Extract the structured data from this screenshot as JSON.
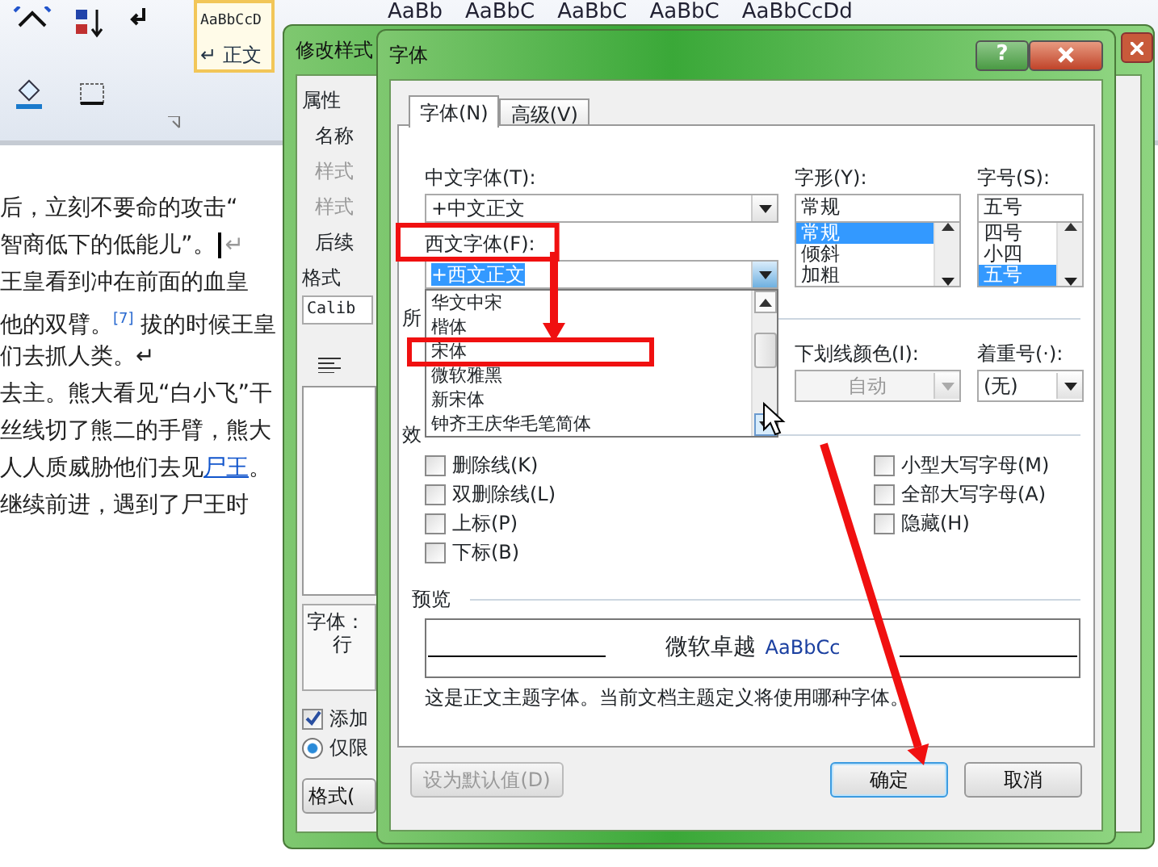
{
  "ribbon": {
    "gallery": [
      {
        "sample": "AaBbCcD",
        "name": "↵ 正文",
        "selected": true
      }
    ],
    "style_samples": [
      "AaBb",
      "AaBbC",
      "AaBbC",
      "AaBbC",
      "AaBbCcDd"
    ]
  },
  "document": {
    "lines": [
      [
        {
          "kind": "text",
          "text": "后，立刻不要命的攻击“"
        }
      ],
      [
        {
          "kind": "text",
          "text": "智商低下的低能儿”。"
        },
        {
          "kind": "caret",
          "text": "↵"
        }
      ],
      [
        {
          "kind": "text",
          "text": "王皇看到冲在前面的血皇"
        }
      ],
      [
        {
          "kind": "text",
          "text": "他的双臂。"
        },
        {
          "kind": "footnote",
          "text": "[7]"
        },
        {
          "kind": "text",
          "text": " 拔的时候王皇"
        }
      ],
      [
        {
          "kind": "text",
          "text": "们去抓人类。↵"
        }
      ],
      [
        {
          "kind": "text",
          "text": "去主。熊大看见“白小飞”干"
        }
      ],
      [
        {
          "kind": "text",
          "text": "丝线切了熊二的手臂，熊大"
        }
      ],
      [
        {
          "kind": "text",
          "text": "人人质威胁他们去见"
        },
        {
          "kind": "link",
          "text": "尸王"
        },
        {
          "kind": "text",
          "text": "。"
        }
      ],
      [
        {
          "kind": "text",
          "text": "继续前进，遇到了尸王时"
        }
      ]
    ]
  },
  "modify_style_dialog": {
    "title": "修改样式",
    "properties_heading": "属性",
    "labels": [
      {
        "text": "名称",
        "disabled": false
      },
      {
        "text": "样式",
        "disabled": true
      },
      {
        "text": "样式",
        "disabled": true
      },
      {
        "text": "后续",
        "disabled": false
      }
    ],
    "format_heading": "格式",
    "font_combo": "Calib",
    "description": [
      "字体：",
      "行"
    ],
    "add_to_gallery": {
      "label": "添加",
      "checked": true
    },
    "this_document_only": {
      "label": "仅限",
      "selected": true
    },
    "format_button": "格式("
  },
  "font_dialog": {
    "title": "字体",
    "help_button": "?",
    "tabs": [
      {
        "label": "字体(N)",
        "selected": true
      },
      {
        "label": "高级(V)",
        "selected": false
      }
    ],
    "chinese_font": {
      "label": "中文字体(T):",
      "value": "+中文正文"
    },
    "western_font": {
      "label": "西文字体(F):",
      "value": "+西文正文",
      "expanded": true,
      "options": [
        {
          "label": "华文中宋",
          "selected": false
        },
        {
          "label": "楷体",
          "selected": false
        },
        {
          "label": "宋体",
          "selected": false
        },
        {
          "label": "微软雅黑",
          "selected": false
        },
        {
          "label": "新宋体",
          "selected": false
        },
        {
          "label": "钟齐王庆华毛笔简体",
          "selected": false
        }
      ]
    },
    "font_style": {
      "label": "字形(Y):",
      "value": "常规",
      "options": [
        {
          "label": "常规",
          "selected": true
        },
        {
          "label": "倾斜",
          "selected": false
        },
        {
          "label": "加粗",
          "selected": false
        }
      ]
    },
    "font_size": {
      "label": "字号(S):",
      "value": "五号",
      "options": [
        {
          "label": "四号",
          "selected": false
        },
        {
          "label": "小四",
          "selected": false
        },
        {
          "label": "五号",
          "selected": true
        }
      ]
    },
    "section_labels": [
      "所",
      "效"
    ],
    "underline_color": {
      "label": "下划线颜色(I):",
      "value": "自动",
      "disabled": true
    },
    "emphasis_mark": {
      "label": "着重号(·):",
      "value": "(无)",
      "disabled": false
    },
    "effects_left": [
      {
        "label": "删除线(K)",
        "checked": false
      },
      {
        "label": "双删除线(L)",
        "checked": false
      },
      {
        "label": "上标(P)",
        "checked": false
      },
      {
        "label": "下标(B)",
        "checked": false
      }
    ],
    "effects_right": [
      {
        "label": "小型大写字母(M)",
        "checked": false
      },
      {
        "label": "全部大写字母(A)",
        "checked": false
      },
      {
        "label": "隐藏(H)",
        "checked": false
      }
    ],
    "preview": {
      "heading": "预览",
      "sample_cn": "微软卓越",
      "sample_en": "AaBbCc"
    },
    "note": "这是正文主题字体。当前文档主题定义将使用哪种字体。",
    "buttons": [
      {
        "label": "设为默认值(D)",
        "disabled": true,
        "default": false
      },
      {
        "label": "确定",
        "disabled": false,
        "default": true
      },
      {
        "label": "取消",
        "disabled": false,
        "default": false
      }
    ]
  }
}
